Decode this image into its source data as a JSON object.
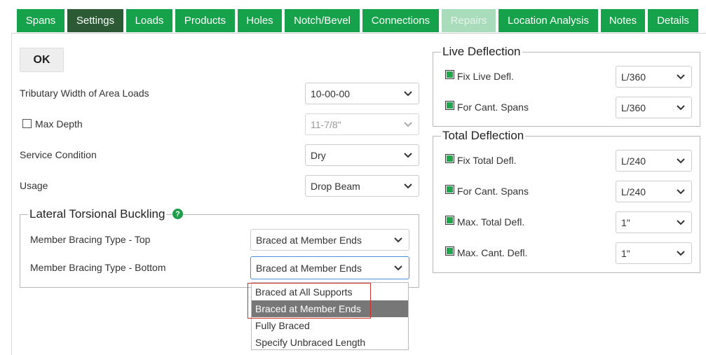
{
  "tabs": [
    {
      "label": "Spans",
      "state": "normal"
    },
    {
      "label": "Settings",
      "state": "active"
    },
    {
      "label": "Loads",
      "state": "normal"
    },
    {
      "label": "Products",
      "state": "normal"
    },
    {
      "label": "Holes",
      "state": "normal"
    },
    {
      "label": "Notch/Bevel",
      "state": "normal"
    },
    {
      "label": "Connections",
      "state": "normal"
    },
    {
      "label": "Repairs",
      "state": "disabled"
    },
    {
      "label": "Location Analysis",
      "state": "normal"
    },
    {
      "label": "Notes",
      "state": "normal"
    },
    {
      "label": "Details",
      "state": "normal"
    }
  ],
  "ok_label": "OK",
  "left": {
    "tributary_label": "Tributary Width of Area Loads",
    "tributary_value": "10-00-00",
    "max_depth_label": "Max Depth",
    "max_depth_checked": false,
    "max_depth_value": "11-7/8\"",
    "service_label": "Service Condition",
    "service_value": "Dry",
    "usage_label": "Usage",
    "usage_value": "Drop Beam"
  },
  "ltb": {
    "legend": "Lateral Torsional Buckling",
    "help_icon": "?",
    "top_label": "Member Bracing Type - Top",
    "top_value": "Braced at Member Ends",
    "bottom_label": "Member Bracing Type - Bottom",
    "bottom_value": "Braced at Member Ends",
    "options": [
      "Braced at All Supports",
      "Braced at Member Ends",
      "Fully Braced",
      "Specify Unbraced Length"
    ],
    "selected_index": 1
  },
  "live": {
    "legend": "Live Deflection",
    "rows": [
      {
        "label": "Fix Live Defl.",
        "value": "L/360",
        "checked": true
      },
      {
        "label": "For Cant. Spans",
        "value": "L/360",
        "checked": true
      }
    ]
  },
  "total": {
    "legend": "Total Deflection",
    "rows": [
      {
        "label": "Fix Total Defl.",
        "value": "L/240",
        "checked": true
      },
      {
        "label": "For Cant. Spans",
        "value": "L/240",
        "checked": true
      },
      {
        "label": "Max. Total Defl.",
        "value": "1\"",
        "checked": true
      },
      {
        "label": "Max. Cant. Defl.",
        "value": "1\"",
        "checked": true
      }
    ]
  },
  "colors": {
    "tab_green": "#15a24a",
    "tab_active": "#2c5a35",
    "tab_disabled": "#a9dcbb",
    "checkbox_green": "#1fa54a",
    "dropdown_selected": "#777777",
    "highlight_red": "#d03030"
  }
}
